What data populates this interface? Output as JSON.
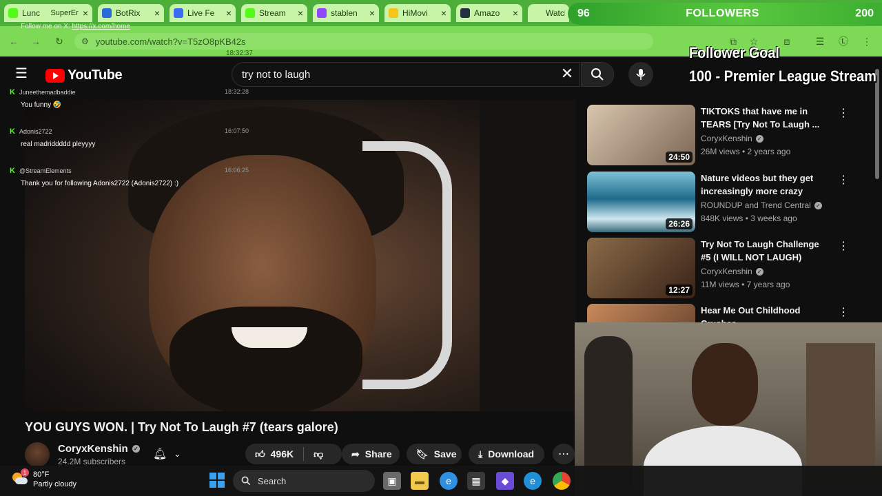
{
  "browser": {
    "tabs": [
      {
        "label": "Lunc",
        "overlay": "SuperEr",
        "icon": "kick-icon",
        "color": "#53fc18"
      },
      {
        "label": "BotRix",
        "icon": "botrix-icon",
        "color": "#2a6bd8"
      },
      {
        "label": "Live Fe",
        "icon": "restream-icon",
        "color": "#3a6cf4"
      },
      {
        "label": "Stream",
        "icon": "kick-icon",
        "color": "#53fc18"
      },
      {
        "label": "stablen",
        "icon": "twitch-icon",
        "color": "#9146ff"
      },
      {
        "label": "HiMovi",
        "icon": "himovies-icon",
        "color": "#f5c518"
      },
      {
        "label": "Amazo",
        "icon": "amazon-icon",
        "color": "#232f3e"
      },
      {
        "label": "Watch",
        "icon": "watch-icon",
        "color": "#c8f4a8"
      }
    ],
    "url": "youtube.com/watch?v=T5zO8pKB42s",
    "overlay_follow_text": "Follow me on X:",
    "overlay_follow_link": "https://x.com/home",
    "overlay_time": "18:32:37"
  },
  "follower_bar": {
    "current": "96",
    "label": "FOLLOWERS",
    "goal": "200"
  },
  "follower_goal": {
    "line1": "Follower Goal",
    "line2": "100 - Premier League Stream"
  },
  "youtube": {
    "search_query": "try not to laugh",
    "logo_text": "YouTube"
  },
  "chat": [
    {
      "user": "Juneethemadbaddie",
      "time": "18:32:28",
      "message": "You funny 🤣"
    },
    {
      "user": "Adonis2722",
      "time": "16:07:50",
      "message": "real madriddddd pleyyyy"
    },
    {
      "user": "@StreamElements",
      "time": "16:06:25",
      "message": "Thank you for following Adonis2722 (Adonis2722) :)"
    }
  ],
  "video": {
    "title": "YOU GUYS WON. | Try Not To Laugh #7 (tears galore)",
    "channel": "CoryxKenshin",
    "subscribers": "24.2M subscribers",
    "likes": "496K",
    "share_label": "Share",
    "save_label": "Save",
    "download_label": "Download"
  },
  "related": [
    {
      "title": "TIKTOKS that have me in TEARS [Try Not To Laugh ...",
      "channel": "CoryxKenshin",
      "verified": true,
      "meta": "26M views • 2 years ago",
      "duration": "24:50",
      "thumb": "#c9b8a4"
    },
    {
      "title": "Nature videos but they get increasingly more crazy",
      "channel": "ROUNDUP and Trend Central",
      "verified": true,
      "meta": "848K views • 3 weeks ago",
      "duration": "26:26",
      "thumb": "#2c7a9a"
    },
    {
      "title": "Try Not To Laugh Challenge #5 (I WILL NOT LAUGH)",
      "channel": "CoryxKenshin",
      "verified": true,
      "meta": "11M views • 7 years ago",
      "duration": "12:27",
      "thumb": "#6a4a30"
    },
    {
      "title": "Hear Me Out Childhood Crushes",
      "channel": "",
      "verified": false,
      "meta": "",
      "duration": "",
      "thumb": "#8a5a4a"
    }
  ],
  "taskbar": {
    "weather_temp": "80°F",
    "weather_desc": "Partly cloudy",
    "weather_badge": "1",
    "search_label": "Search"
  }
}
